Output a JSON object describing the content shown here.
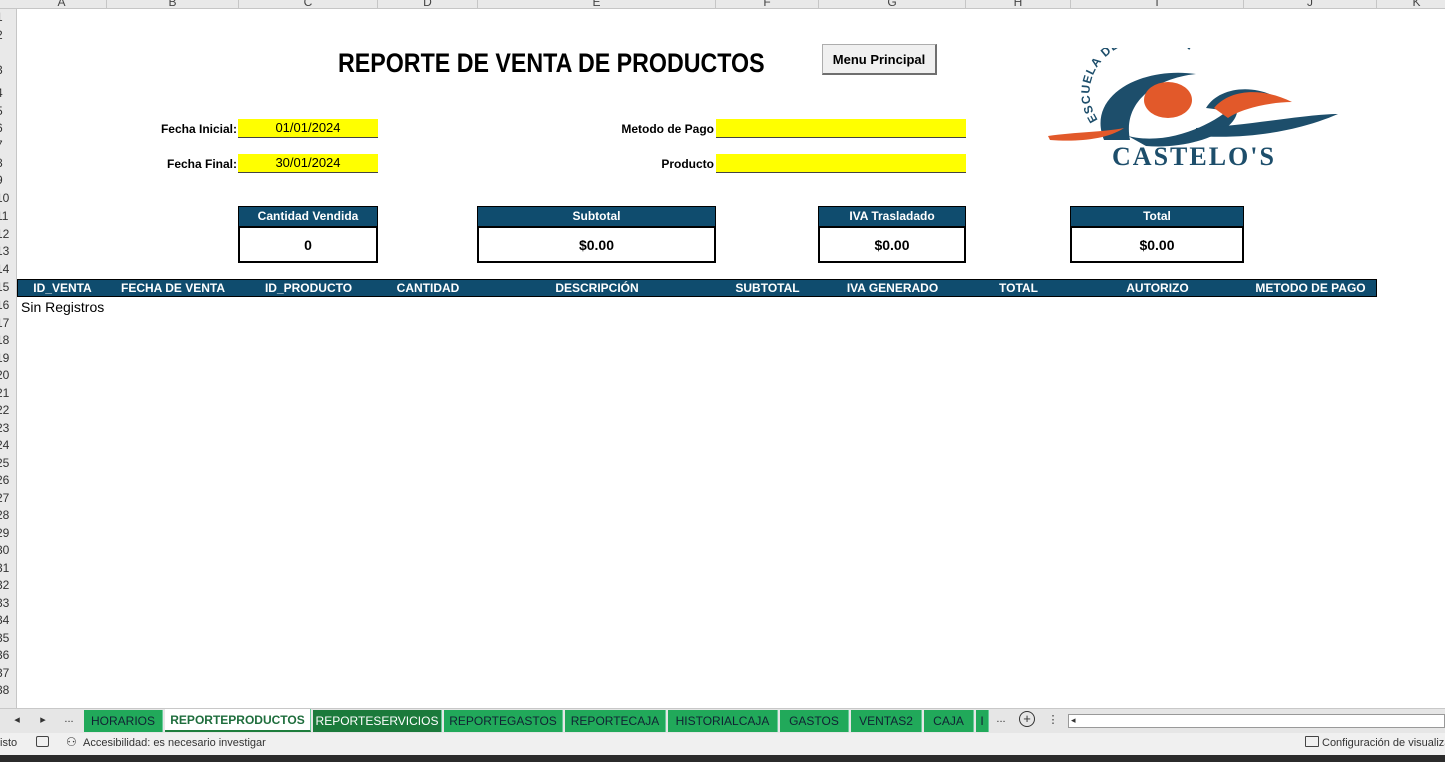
{
  "columns": [
    "A",
    "B",
    "C",
    "D",
    "E",
    "F",
    "G",
    "H",
    "I",
    "J",
    "K"
  ],
  "rows": [
    "1",
    "2",
    "3",
    "4",
    "5",
    "6",
    "7",
    "8",
    "9",
    "10",
    "11",
    "12",
    "13",
    "14",
    "15",
    "16",
    "17",
    "18",
    "19",
    "20",
    "21",
    "22",
    "23",
    "24",
    "25",
    "26",
    "27",
    "28",
    "29",
    "30",
    "31",
    "32",
    "33",
    "34",
    "35",
    "36",
    "37",
    "38"
  ],
  "report": {
    "title": "REPORTE DE VENTA DE PRODUCTOS",
    "menu_button": "Menu Principal",
    "fecha_inicial_label": "Fecha Inicial:",
    "fecha_inicial_value": "01/01/2024",
    "fecha_final_label": "Fecha Final:",
    "fecha_final_value": "30/01/2024",
    "metodo_pago_label": "Metodo de Pago",
    "metodo_pago_value": "",
    "producto_label": "Producto",
    "producto_value": ""
  },
  "logo": {
    "arc_text": "ESCUELA DE NATACIÓN",
    "name": "CASTELO'S",
    "colors": {
      "blue": "#1d4e6b",
      "orange": "#e2592a"
    }
  },
  "kpis": [
    {
      "label": "Cantidad Vendida",
      "value": "0"
    },
    {
      "label": "Subtotal",
      "value": "$0.00"
    },
    {
      "label": "IVA Trasladado",
      "value": "$0.00"
    },
    {
      "label": "Total",
      "value": "$0.00"
    }
  ],
  "table": {
    "headers": [
      "ID_VENTA",
      "FECHA DE VENTA",
      "ID_PRODUCTO",
      "CANTIDAD",
      "DESCRIPCIÓN",
      "SUBTOTAL",
      "IVA GENERADO",
      "TOTAL",
      "AUTORIZO",
      "METODO DE PAGO"
    ],
    "empty_text": "Sin Registros"
  },
  "sheet_tabs": {
    "nav_prev": "◂",
    "nav_next": "▸",
    "nav_more": "...",
    "tabs": [
      "HORARIOS",
      "REPORTEPRODUCTOS",
      "REPORTESERVICIOS",
      "REPORTEGASTOS",
      "REPORTECAJA",
      "HISTORIALCAJA",
      "GASTOS",
      "VENTAS2",
      "CAJA",
      "I"
    ],
    "active": "REPORTEPRODUCTOS",
    "more": "...",
    "add": "+",
    "options": "⋮"
  },
  "status_bar": {
    "ready": "isto",
    "accessibility": "Accesibilidad: es necesario investigar",
    "display_settings": "Configuración de visualiza"
  },
  "colors": {
    "header_blue": "#0f4c6e",
    "input_yellow": "#ffff00",
    "tab_green": "#21a95a"
  }
}
